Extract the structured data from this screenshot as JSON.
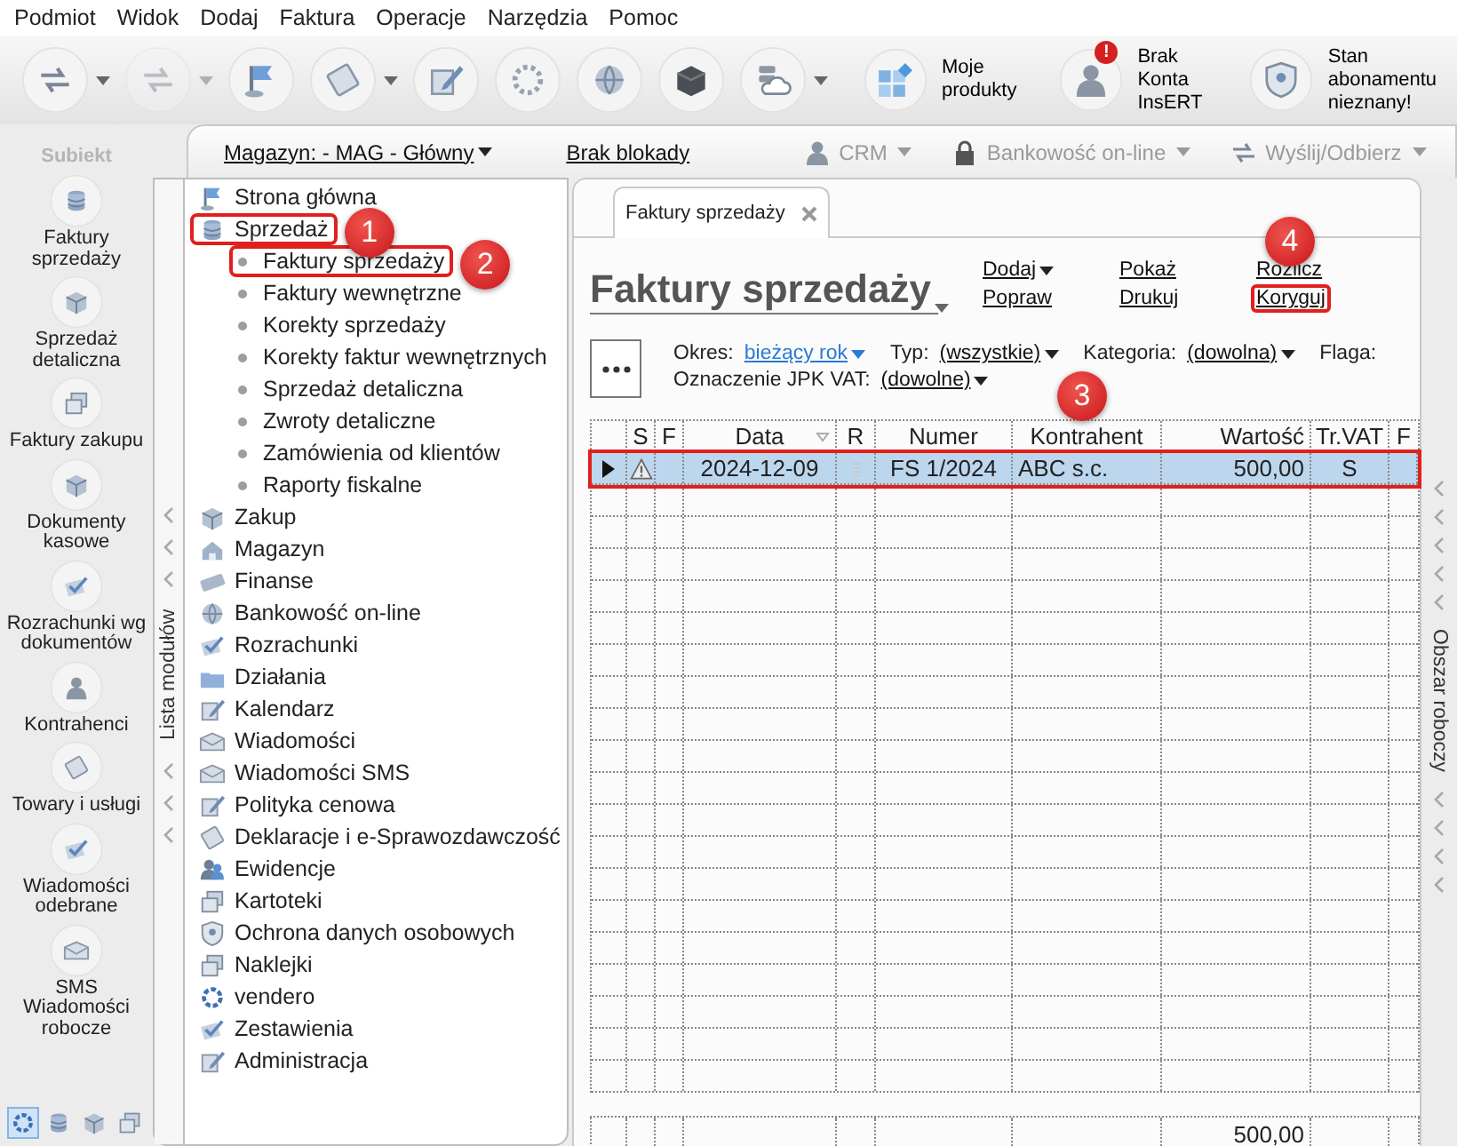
{
  "menu": [
    "Podmiot",
    "Widok",
    "Dodaj",
    "Faktura",
    "Operacje",
    "Narzędzia",
    "Pomoc"
  ],
  "toolbar": {
    "tools": [
      {
        "dropdown": true,
        "disabled": false
      },
      {
        "dropdown": true,
        "disabled": true
      },
      {
        "dropdown": false,
        "disabled": false
      },
      {
        "dropdown": true,
        "disabled": false
      },
      {
        "dropdown": false,
        "disabled": false
      },
      {
        "dropdown": false,
        "disabled": false
      },
      {
        "dropdown": false,
        "disabled": false
      },
      {
        "dropdown": false,
        "disabled": false
      },
      {
        "dropdown": true,
        "disabled": false
      }
    ],
    "actions": [
      {
        "label": "Moje\nprodukty"
      },
      {
        "label": "Brak Konta\nInsERT",
        "badge": "!"
      },
      {
        "label": "Stan abonamentu\nnieznany!"
      }
    ]
  },
  "sidebar": {
    "logo": "Subiekt",
    "shortcuts": [
      {
        "label": "Faktury\nsprzedaży"
      },
      {
        "label": "Sprzedaż\ndetaliczna"
      },
      {
        "label": "Faktury zakupu"
      },
      {
        "label": "Dokumenty\nkasowe"
      },
      {
        "label": "Rozrachunki wg\ndokumentów"
      },
      {
        "label": "Kontrahenci"
      },
      {
        "label": "Towary i usługi"
      },
      {
        "label": "Wiadomości\nodebrane"
      },
      {
        "label": "SMS\nWiadomości\nrobocze"
      }
    ],
    "footer_buttons": [
      {
        "selected": true
      },
      {
        "selected": false
      },
      {
        "selected": false
      },
      {
        "selected": false
      }
    ]
  },
  "top_bar": {
    "warehouse": "Magazyn: - MAG - Główny",
    "lock_status": "Brak blokady",
    "modules": [
      {
        "label": "CRM",
        "disabled": true
      },
      {
        "label": "Bankowość on-line",
        "disabled": true
      },
      {
        "label": "Wyślij/Odbierz",
        "disabled": true
      }
    ]
  },
  "module_panel": {
    "title": "Lista modułów",
    "items": [
      {
        "label": "Strona główna",
        "highlighted": false
      },
      {
        "label": "Sprzedaż",
        "highlighted": true,
        "callout": "1",
        "children": [
          {
            "label": "Faktury sprzedaży",
            "highlighted": true,
            "callout": "2"
          },
          {
            "label": "Faktury wewnętrzne",
            "highlighted": false
          },
          {
            "label": "Korekty sprzedaży",
            "highlighted": false
          },
          {
            "label": "Korekty faktur wewnętrznych",
            "highlighted": false
          },
          {
            "label": "Sprzedaż detaliczna",
            "highlighted": false
          },
          {
            "label": "Zwroty detaliczne",
            "highlighted": false
          },
          {
            "label": "Zamówienia od klientów",
            "highlighted": false
          },
          {
            "label": "Raporty fiskalne",
            "highlighted": false
          }
        ]
      },
      {
        "label": "Zakup",
        "highlighted": false
      },
      {
        "label": "Magazyn",
        "highlighted": false
      },
      {
        "label": "Finanse",
        "highlighted": false
      },
      {
        "label": "Bankowość on-line",
        "highlighted": false
      },
      {
        "label": "Rozrachunki",
        "highlighted": false
      },
      {
        "label": "Działania",
        "highlighted": false
      },
      {
        "label": "Kalendarz",
        "highlighted": false
      },
      {
        "label": "Wiadomości",
        "highlighted": false
      },
      {
        "label": "Wiadomości SMS",
        "highlighted": false
      },
      {
        "label": "Polityka cenowa",
        "highlighted": false
      },
      {
        "label": "Deklaracje i e-Sprawozdawczość",
        "highlighted": false
      },
      {
        "label": "Ewidencje",
        "highlighted": false
      },
      {
        "label": "Kartoteki",
        "highlighted": false
      },
      {
        "label": "Ochrona danych osobowych",
        "highlighted": false
      },
      {
        "label": "Naklejki",
        "highlighted": false
      },
      {
        "label": "vendero",
        "highlighted": false
      },
      {
        "label": "Zestawienia",
        "highlighted": false
      },
      {
        "label": "Administracja",
        "highlighted": false
      }
    ]
  },
  "document_tab": {
    "title": "Faktury sprzedaży"
  },
  "work_area_label": "Obszar roboczy",
  "list": {
    "heading": "Faktury sprzedaży",
    "actions": [
      {
        "label": "Dodaj",
        "dropdown": true,
        "highlighted": false
      },
      {
        "label": "Popraw",
        "dropdown": false,
        "highlighted": false
      },
      {
        "label": "Pokaż",
        "dropdown": false,
        "highlighted": false
      },
      {
        "label": "Drukuj",
        "dropdown": false,
        "highlighted": false
      },
      {
        "label": "Rozlicz",
        "dropdown": false,
        "highlighted": false
      },
      {
        "label": "Koryguj",
        "dropdown": false,
        "highlighted": true,
        "callout": "4"
      }
    ],
    "filter_rows": [
      [
        {
          "label": "Okres:",
          "value": "bieżący rok",
          "kind": "active"
        },
        {
          "label": "Typ:",
          "value": "(wszystkie)",
          "kind": "default"
        },
        {
          "label": "Kategoria:",
          "value": "(dowolna)",
          "kind": "default"
        },
        {
          "label": "Flaga:"
        }
      ],
      [
        {
          "label": "Oznaczenie JPK VAT:",
          "value": "(dowolne)",
          "kind": "default"
        }
      ]
    ]
  },
  "table": {
    "columns": [
      {
        "label": "S",
        "sorted": false
      },
      {
        "label": "F",
        "sorted": false
      },
      {
        "label": "Data",
        "sorted": true
      },
      {
        "label": "R",
        "sorted": false
      },
      {
        "label": "Numer",
        "sorted": false
      },
      {
        "label": "Kontrahent",
        "sorted": false
      },
      {
        "label": "Wartość",
        "sorted": false
      },
      {
        "label": "Tr.VAT",
        "sorted": false
      },
      {
        "label": "F",
        "sorted": false
      }
    ],
    "rows": [
      {
        "selected": true,
        "highlighted": true,
        "callout": "3",
        "warning": true,
        "date": "2024-12-09",
        "number": "FS 1/2024",
        "contractor": "ABC s.c.",
        "value": "500,00",
        "vat": "S"
      }
    ],
    "total_value": "500,00"
  }
}
